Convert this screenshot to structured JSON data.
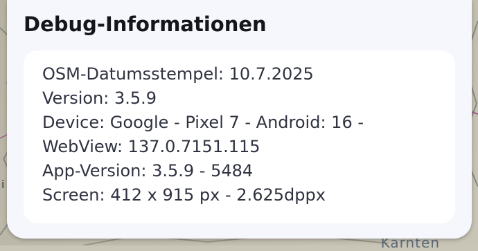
{
  "dialog": {
    "title": "Debug-Informationen",
    "lines": [
      "OSM-Datumsstempel: 10.7.2025",
      "Version: 3.5.9",
      "Device: Google - Pixel 7 - Android: 16 -",
      "WebView: 137.0.7151.115",
      "App-Version: 3.5.9 - 5484",
      "Screen: 412 x 915 px - 2.625dppx"
    ]
  },
  "map": {
    "label": "Kärnten"
  },
  "colors": {
    "dialog_bg": "#f5f7fc",
    "card_bg": "#ffffff",
    "title_text": "#14161c",
    "body_text": "#2f3340"
  }
}
